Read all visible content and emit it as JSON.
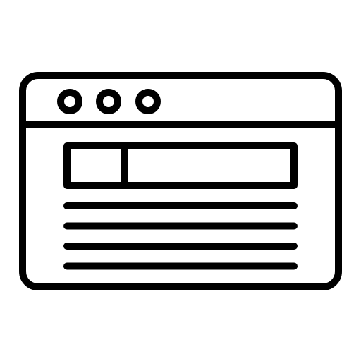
{
  "icon": {
    "name": "browser-window-icon",
    "stroke_color": "#000000",
    "background_color": "#ffffff",
    "window_controls": [
      "dot-1",
      "dot-2",
      "dot-3"
    ],
    "content_text_lines": 4
  }
}
